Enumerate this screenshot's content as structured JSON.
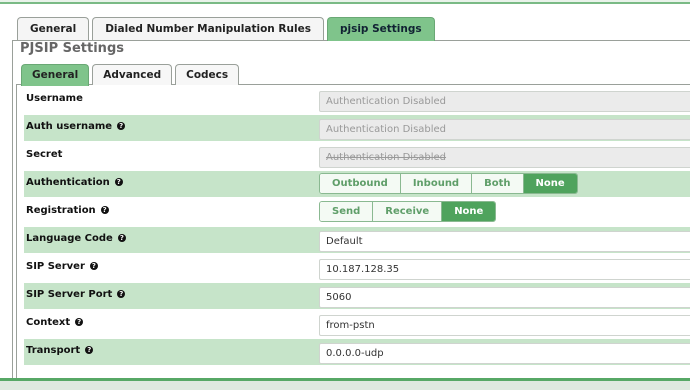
{
  "main_tabs": [
    {
      "label": "General",
      "active": false
    },
    {
      "label": "Dialed Number Manipulation Rules",
      "active": false
    },
    {
      "label": "pjsip Settings",
      "active": true
    }
  ],
  "section_title": "PJSIP Settings",
  "sub_tabs": [
    {
      "label": "General",
      "active": true
    },
    {
      "label": "Advanced",
      "active": false
    },
    {
      "label": "Codecs",
      "active": false
    }
  ],
  "fields": {
    "username": {
      "label": "Username",
      "value": "Authentication Disabled"
    },
    "auth_username": {
      "label": "Auth username",
      "value": "Authentication Disabled"
    },
    "secret": {
      "label": "Secret",
      "value": "Authentication Disabled"
    },
    "authentication": {
      "label": "Authentication",
      "options": [
        "Outbound",
        "Inbound",
        "Both",
        "None"
      ],
      "selected": "None"
    },
    "registration": {
      "label": "Registration",
      "options": [
        "Send",
        "Receive",
        "None"
      ],
      "selected": "None"
    },
    "language_code": {
      "label": "Language Code",
      "value": "Default"
    },
    "sip_server": {
      "label": "SIP Server",
      "value": "10.187.128.35"
    },
    "sip_server_port": {
      "label": "SIP Server Port",
      "value": "5060"
    },
    "context": {
      "label": "Context",
      "value": "from-pstn"
    },
    "transport": {
      "label": "Transport",
      "value": "0.0.0.0-udp"
    }
  },
  "colors": {
    "accent": "#4fa35d",
    "row_highlight": "#c6e4c9",
    "tab_active": "#7fc48b"
  }
}
